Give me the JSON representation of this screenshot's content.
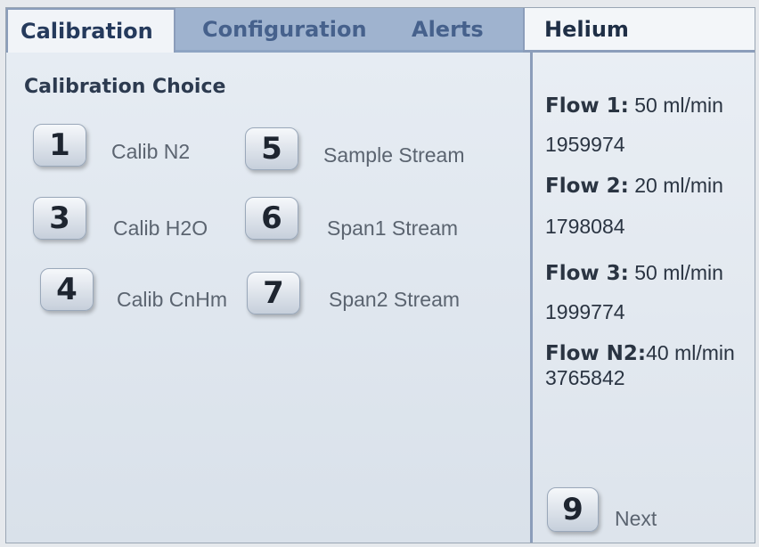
{
  "tabs": {
    "calibration": "Calibration",
    "configuration": "Configuration",
    "alerts": "Alerts",
    "gas": "Helium"
  },
  "main": {
    "section_title": "Calibration Choice",
    "buttons": [
      {
        "key": "1",
        "label": "Calib N2"
      },
      {
        "key": "3",
        "label": "Calib H2O"
      },
      {
        "key": "4",
        "label": "Calib CnHm"
      },
      {
        "key": "5",
        "label": "Sample Stream"
      },
      {
        "key": "6",
        "label": "Span1 Stream"
      },
      {
        "key": "7",
        "label": "Span2 Stream"
      }
    ]
  },
  "side": {
    "flows": [
      {
        "name": "Flow 1:",
        "rate": " 50 ml/min",
        "value": "1959974"
      },
      {
        "name": "Flow 2:",
        "rate": " 20 ml/min",
        "value": "1798084"
      },
      {
        "name": "Flow 3:",
        "rate": " 50 ml/min",
        "value": "1999774"
      },
      {
        "name": "Flow N2:",
        "rate": "40 ml/min",
        "value": "3765842"
      }
    ],
    "next": {
      "key": "9",
      "label": "Next"
    }
  },
  "colors": {
    "tab_bar": "#9fb3cf",
    "active_tab": "#f1f4f8",
    "panel": "#dde4ec",
    "tab_text": "#46618c"
  }
}
